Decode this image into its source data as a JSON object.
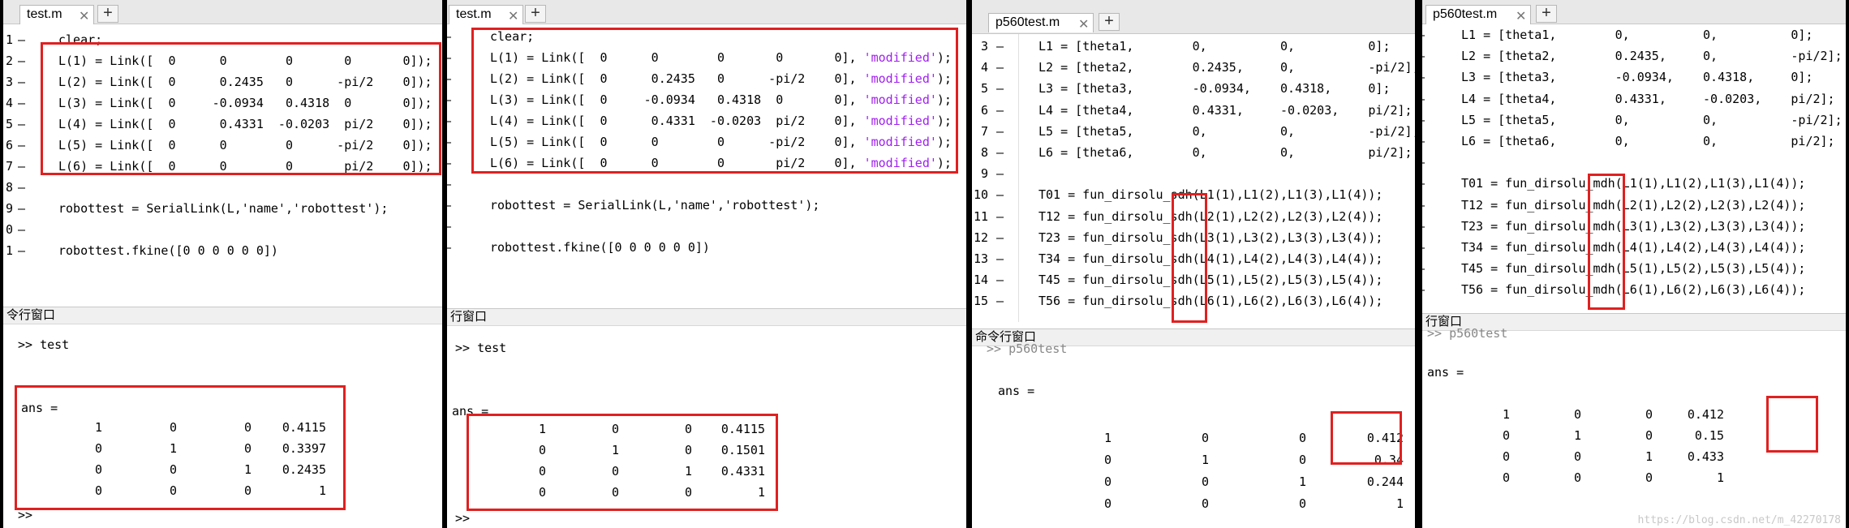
{
  "panel1": {
    "tab": "test.m",
    "lines": [
      {
        "n": "1",
        "code": "clear;"
      },
      {
        "n": "2",
        "code": "L(1) = Link([  0      0        0       0       0]);"
      },
      {
        "n": "3",
        "code": "L(2) = Link([  0      0.2435   0      -pi/2    0]);"
      },
      {
        "n": "4",
        "code": "L(3) = Link([  0     -0.0934   0.4318  0       0]);"
      },
      {
        "n": "5",
        "code": "L(4) = Link([  0      0.4331  -0.0203  pi/2    0]);"
      },
      {
        "n": "6",
        "code": "L(5) = Link([  0      0        0      -pi/2    0]);"
      },
      {
        "n": "7",
        "code": "L(6) = Link([  0      0        0       pi/2    0]);"
      },
      {
        "n": "8",
        "code": ""
      },
      {
        "n": "9",
        "code": "robottest = SerialLink(L,'name','robottest');"
      },
      {
        "n": "0",
        "code": ""
      },
      {
        "n": "1",
        "code": "robottest.fkine([0 0 0 0 0 0])"
      }
    ],
    "cmd_title": "令行窗口",
    "prompt": ">> test",
    "ans": "ans =",
    "matrix": [
      [
        "1",
        "0",
        "0",
        "0.4115"
      ],
      [
        "0",
        "1",
        "0",
        "0.3397"
      ],
      [
        "0",
        "0",
        "1",
        "0.2435"
      ],
      [
        "0",
        "0",
        "0",
        "1"
      ]
    ],
    "bottom_prompt": ">>"
  },
  "panel2": {
    "tab": "test.m",
    "lines": [
      {
        "code": "clear;"
      },
      {
        "code": "L(1) = Link([  0      0        0       0       0], ",
        "str": "'modified'",
        "end": ");"
      },
      {
        "code": "L(2) = Link([  0      0.2435   0      -pi/2    0], ",
        "str": "'modified'",
        "end": ");"
      },
      {
        "code": "L(3) = Link([  0     -0.0934   0.4318  0       0], ",
        "str": "'modified'",
        "end": ");"
      },
      {
        "code": "L(4) = Link([  0      0.4331  -0.0203  pi/2    0], ",
        "str": "'modified'",
        "end": ");"
      },
      {
        "code": "L(5) = Link([  0      0        0      -pi/2    0], ",
        "str": "'modified'",
        "end": ");"
      },
      {
        "code": "L(6) = Link([  0      0        0       pi/2    0], ",
        "str": "'modified'",
        "end": ");"
      },
      {
        "code": ""
      },
      {
        "code": "robottest = SerialLink(L,'name','robottest');"
      },
      {
        "code": ""
      },
      {
        "code": "robottest.fkine([0 0 0 0 0 0])"
      }
    ],
    "cmd_title": "行窗口",
    "prompt": ">> test",
    "ans": "ans =",
    "matrix": [
      [
        "1",
        "0",
        "0",
        "0.4115"
      ],
      [
        "0",
        "1",
        "0",
        "0.1501"
      ],
      [
        "0",
        "0",
        "1",
        "0.4331"
      ],
      [
        "0",
        "0",
        "0",
        "1"
      ]
    ],
    "bottom_prompt": ">>"
  },
  "panel3": {
    "tab": "p560test.m",
    "lines": [
      {
        "n": "3",
        "code": "L1 = [theta1,        0,          0,          0];"
      },
      {
        "n": "4",
        "code": "L2 = [theta2,        0.2435,     0,          -pi/2];"
      },
      {
        "n": "5",
        "code": "L3 = [theta3,        -0.0934,    0.4318,     0];"
      },
      {
        "n": "6",
        "code": "L4 = [theta4,        0.4331,     -0.0203,    pi/2];"
      },
      {
        "n": "7",
        "code": "L5 = [theta5,        0,          0,          -pi/2];"
      },
      {
        "n": "8",
        "code": "L6 = [theta6,        0,          0,          pi/2];"
      },
      {
        "n": "9",
        "code": ""
      },
      {
        "n": "10",
        "code": "T01 = fun_dirsolu_sdh(L1(1),L1(2),L1(3),L1(4));"
      },
      {
        "n": "11",
        "code": "T12 = fun_dirsolu_sdh(L2(1),L2(2),L2(3),L2(4));"
      },
      {
        "n": "12",
        "code": "T23 = fun_dirsolu_sdh(L3(1),L3(2),L3(3),L3(4));"
      },
      {
        "n": "13",
        "code": "T34 = fun_dirsolu_sdh(L4(1),L4(2),L4(3),L4(4));"
      },
      {
        "n": "14",
        "code": "T45 = fun_dirsolu_sdh(L5(1),L5(2),L5(3),L5(4));"
      },
      {
        "n": "15",
        "code": "T56 = fun_dirsolu_sdh(L6(1),L6(2),L6(3),L6(4));"
      }
    ],
    "cmd_title": "命令行窗口",
    "prompt": ">> p560test",
    "ans": "ans =",
    "matrix": [
      [
        "1",
        "0",
        "0",
        "0.412"
      ],
      [
        "0",
        "1",
        "0",
        "0.34"
      ],
      [
        "0",
        "0",
        "1",
        "0.244"
      ],
      [
        "0",
        "0",
        "0",
        "1"
      ]
    ]
  },
  "panel4": {
    "tab": "p560test.m",
    "lines": [
      {
        "code": "L1 = [theta1,        0,          0,          0];"
      },
      {
        "code": "L2 = [theta2,        0.2435,     0,          -pi/2];"
      },
      {
        "code": "L3 = [theta3,        -0.0934,    0.4318,     0];"
      },
      {
        "code": "L4 = [theta4,        0.4331,     -0.0203,    pi/2];"
      },
      {
        "code": "L5 = [theta5,        0,          0,          -pi/2];"
      },
      {
        "code": "L6 = [theta6,        0,          0,          pi/2];"
      },
      {
        "code": ""
      },
      {
        "code": "T01 = fun_dirsolu_mdh(L1(1),L1(2),L1(3),L1(4));"
      },
      {
        "code": "T12 = fun_dirsolu_mdh(L2(1),L2(2),L2(3),L2(4));"
      },
      {
        "code": "T23 = fun_dirsolu_mdh(L3(1),L3(2),L3(3),L3(4));"
      },
      {
        "code": "T34 = fun_dirsolu_mdh(L4(1),L4(2),L4(3),L4(4));"
      },
      {
        "code": "T45 = fun_dirsolu_mdh(L5(1),L5(2),L5(3),L5(4));"
      },
      {
        "code": "T56 = fun_dirsolu_mdh(L6(1),L6(2),L6(3),L6(4));"
      }
    ],
    "cmd_title": "行窗口",
    "prompt": ">> p560test",
    "ans": "ans =",
    "matrix": [
      [
        "1",
        "0",
        "0",
        "0.412"
      ],
      [
        "0",
        "1",
        "0",
        "0.15"
      ],
      [
        "0",
        "0",
        "1",
        "0.433"
      ],
      [
        "0",
        "0",
        "0",
        "1"
      ]
    ],
    "watermark": "https://blog.csdn.net/m_42270178"
  },
  "colors": {
    "highlight": "#e02020",
    "string": "#a020f0"
  },
  "icons": {
    "close": "close-icon",
    "add": "add-tab-icon"
  }
}
